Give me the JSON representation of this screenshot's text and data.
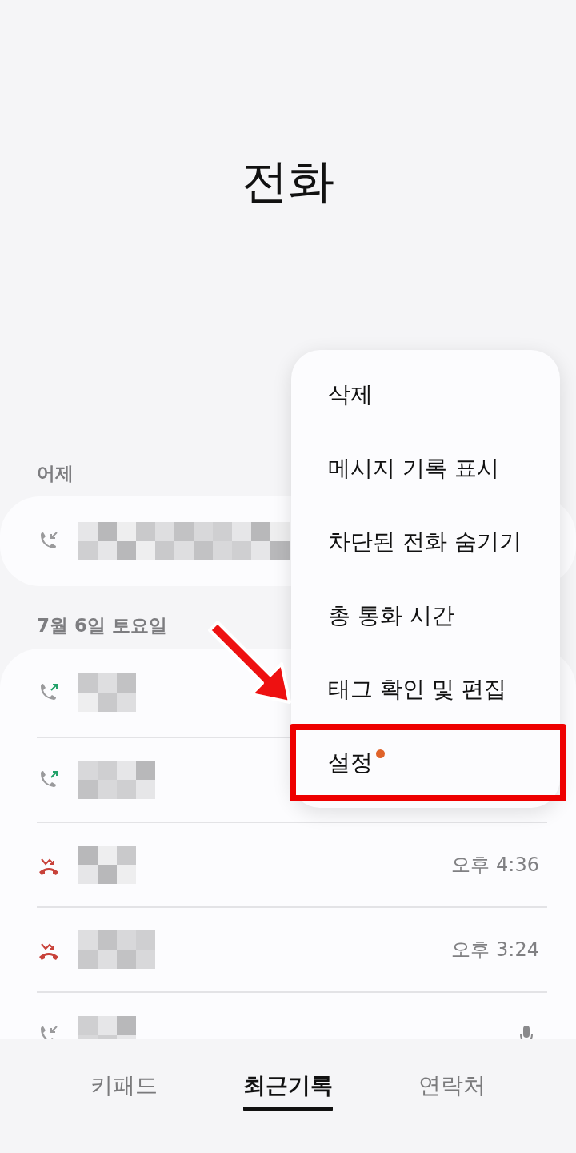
{
  "title": "전화",
  "sections": [
    {
      "label": "어제",
      "calls": [
        {
          "kind": "incoming",
          "voice_memo": false
        }
      ]
    },
    {
      "label": "7월 6일 토요일",
      "calls": [
        {
          "kind": "outgoing",
          "voice_memo": false
        },
        {
          "kind": "outgoing",
          "voice_memo": false
        },
        {
          "kind": "missed",
          "time": "오후 4:36",
          "voice_memo": false
        },
        {
          "kind": "missed",
          "time": "오후 3:24",
          "voice_memo": false
        },
        {
          "kind": "incoming",
          "voice_memo": true
        }
      ]
    }
  ],
  "menu": [
    {
      "label": "삭제",
      "new_badge": false,
      "highlighted": false
    },
    {
      "label": "메시지 기록 표시",
      "new_badge": false,
      "highlighted": false
    },
    {
      "label": "차단된 전화 숨기기",
      "new_badge": false,
      "highlighted": false
    },
    {
      "label": "총 통화 시간",
      "new_badge": false,
      "highlighted": false
    },
    {
      "label": "태그 확인 및 편집",
      "new_badge": false,
      "highlighted": false
    },
    {
      "label": "설정",
      "new_badge": true,
      "highlighted": true
    }
  ],
  "tabs": [
    {
      "label": "키패드",
      "selected": false
    },
    {
      "label": "최근기록",
      "selected": true
    },
    {
      "label": "연락처",
      "selected": false
    }
  ]
}
